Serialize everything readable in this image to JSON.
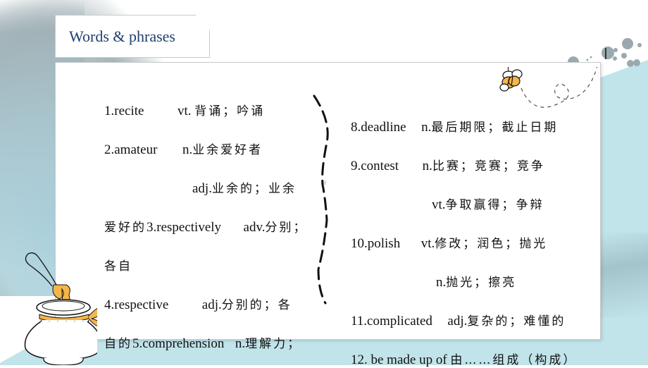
{
  "slide": {
    "title": "Words & phrases",
    "title_color": "#1f3f6e",
    "accent_color": "#c1e3ea",
    "left_column": [
      {
        "id": "line1",
        "en": "1.recite",
        "pos": "vt.",
        "cn": "背诵；吟诵"
      },
      {
        "id": "line2",
        "en": "2.amateur",
        "pos": "n.",
        "cn": "业余爱好者"
      },
      {
        "id": "line3",
        "en": "",
        "pos": "adj.",
        "cn": "业余的；业余"
      },
      {
        "id": "line4",
        "pre": "爱好的",
        "en": "3.respectively",
        "pos": "adv.",
        "cn": "分别；"
      },
      {
        "id": "line5",
        "cn": "各自"
      },
      {
        "id": "line6",
        "en": "4.respective",
        "pos": "adj.",
        "cn": "分别的；各"
      },
      {
        "id": "line7",
        "pre": "自的",
        "en": "5.comprehension",
        "pos": "n.",
        "cn": "理解力；"
      }
    ],
    "right_column": [
      {
        "id": "r1",
        "en": "8.deadline",
        "pos": "n.",
        "cn": "最后期限；截止日期"
      },
      {
        "id": "r2",
        "en": "9.contest",
        "pos": "n.",
        "cn": "比赛；竞赛；竞争"
      },
      {
        "id": "r3",
        "en": "",
        "pos": "vt.",
        "cn": "争取赢得；争辩"
      },
      {
        "id": "r4",
        "en": "10.polish",
        "pos": "vt.",
        "cn": "修改；润色；抛光"
      },
      {
        "id": "r5",
        "en": "",
        "pos": "n.",
        "cn": "抛光；擦亮"
      },
      {
        "id": "r6",
        "en": "11.complicated",
        "pos": "adj.",
        "cn": "复杂的；难懂的"
      },
      {
        "id": "r7",
        "en": "12. be made up of",
        "pos": "",
        "cn": "由……组成（构成）"
      }
    ],
    "decorations": [
      "bee-icon",
      "honey-jar-icon",
      "dashed-bracket",
      "ink-splash"
    ]
  }
}
